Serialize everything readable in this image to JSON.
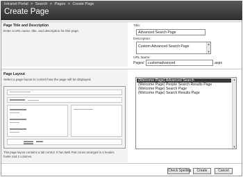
{
  "breadcrumb": [
    "Intranet Portal",
    "Search",
    "Pages",
    "Create Page"
  ],
  "breadcrumb_separator": ">",
  "page_title": "Create Page",
  "title_section": {
    "heading": "Page Title and Description",
    "description": "Enter a URL name, title, and description for this page."
  },
  "fields": {
    "title_label": "Title:",
    "title_value": "Advanced Search Page",
    "description_label": "Description:",
    "description_value": "Custom Advanced Search Page",
    "url_label": "URL Name:",
    "url_prefix": "Pages/",
    "url_value": "customadvanced",
    "url_suffix": ".aspx"
  },
  "layout_section": {
    "heading": "Page Layout",
    "description": "Select a page layout to control how the page will be displayed.",
    "caption_line1": "This page layout contains a tab control. It has Web Part zones arranged in a header,",
    "caption_line2": "footer and 2 columns."
  },
  "layout_options": [
    "(Welcome Page) Advanced Search",
    "(Welcome Page) People Search Results Page",
    "(Welcome Page) Search Page",
    "(Welcome Page) Search Results Page"
  ],
  "layout_selected_index": 0,
  "buttons": {
    "check_spelling": "Check Spelling",
    "create": "Create",
    "cancel": "Cancel"
  },
  "colors": {
    "header_bg": "#3a3a3a",
    "selected_item_bg": "#3a3a3a",
    "panel_bg": "#f3f3f3"
  }
}
